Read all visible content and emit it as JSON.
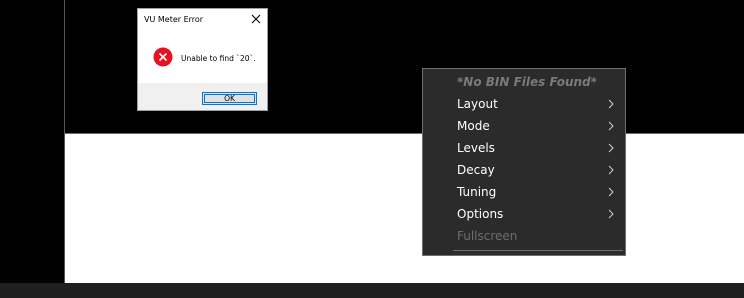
{
  "dialog": {
    "title": "VU Meter Error",
    "message": "Unable to find `20`.",
    "ok_label": "OK",
    "icon": "error-icon"
  },
  "context_menu": {
    "items": [
      {
        "label": "*No BIN Files Found*",
        "enabled": false,
        "submenu": false
      },
      {
        "label": "Layout",
        "enabled": true,
        "submenu": true
      },
      {
        "label": "Mode",
        "enabled": true,
        "submenu": true
      },
      {
        "label": "Levels",
        "enabled": true,
        "submenu": true
      },
      {
        "label": "Decay",
        "enabled": true,
        "submenu": true
      },
      {
        "label": "Tuning",
        "enabled": true,
        "submenu": true
      },
      {
        "label": "Options",
        "enabled": true,
        "submenu": true
      },
      {
        "label": "Fullscreen",
        "enabled": false,
        "submenu": false
      }
    ]
  },
  "colors": {
    "menu_bg": "#2b2b2b",
    "error_red": "#e81123",
    "accent_blue": "#0078d7"
  }
}
